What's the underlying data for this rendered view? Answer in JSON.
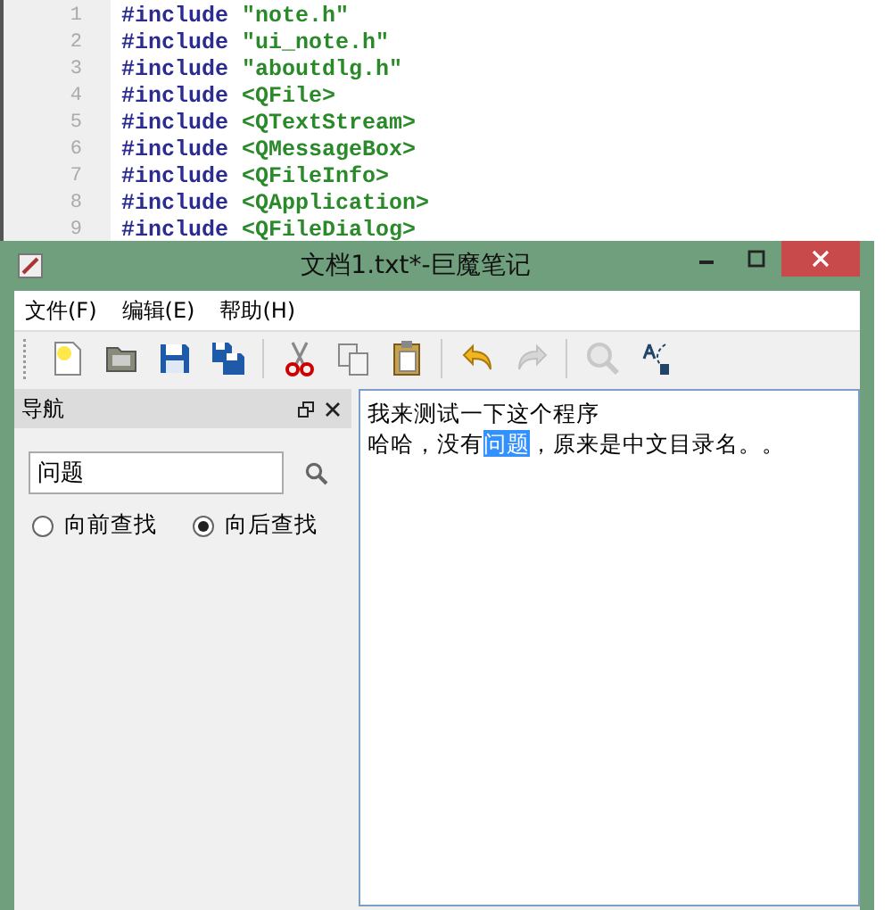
{
  "background_editor": {
    "lines": [
      {
        "number": "1",
        "directive": "#include",
        "argument": "\"note.h\""
      },
      {
        "number": "2",
        "directive": "#include",
        "argument": "\"ui_note.h\""
      },
      {
        "number": "3",
        "directive": "#include",
        "argument": "\"aboutdlg.h\""
      },
      {
        "number": "4",
        "directive": "#include",
        "argument": "<QFile>"
      },
      {
        "number": "5",
        "directive": "#include",
        "argument": "<QTextStream>"
      },
      {
        "number": "6",
        "directive": "#include",
        "argument": "<QMessageBox>"
      },
      {
        "number": "7",
        "directive": "#include",
        "argument": "<QFileInfo>"
      },
      {
        "number": "8",
        "directive": "#include",
        "argument": "<QApplication>"
      },
      {
        "number": "9",
        "directive": "#include",
        "argument": "<QFileDialog>"
      }
    ]
  },
  "window": {
    "title": "文档1.txt*-巨魔笔记"
  },
  "menu": [
    "文件(F)",
    "编辑(E)",
    "帮助(H)"
  ],
  "toolbar": [
    {
      "kind": "new",
      "disabled": false
    },
    {
      "kind": "open",
      "disabled": false
    },
    {
      "kind": "save",
      "disabled": false
    },
    {
      "kind": "save-all",
      "disabled": false
    },
    {
      "kind": "sep"
    },
    {
      "kind": "cut",
      "disabled": false
    },
    {
      "kind": "copy",
      "disabled": false
    },
    {
      "kind": "paste",
      "disabled": false
    },
    {
      "kind": "sep"
    },
    {
      "kind": "undo",
      "disabled": false
    },
    {
      "kind": "redo",
      "disabled": true
    },
    {
      "kind": "sep"
    },
    {
      "kind": "find",
      "disabled": true
    },
    {
      "kind": "replace",
      "disabled": false
    }
  ],
  "navigation": {
    "title": "导航",
    "search": {
      "value": "问题"
    },
    "options": [
      {
        "label": "向前查找",
        "selected": false
      },
      {
        "label": "向后查找",
        "selected": true
      }
    ]
  },
  "document": {
    "lines": [
      [
        {
          "text": "我来测试一下这个程序",
          "selected": false
        }
      ],
      [
        {
          "text": "哈哈，没有",
          "selected": false
        },
        {
          "text": "问题",
          "selected": true
        },
        {
          "text": "，原来是中文目录名。。",
          "selected": false
        }
      ]
    ]
  }
}
